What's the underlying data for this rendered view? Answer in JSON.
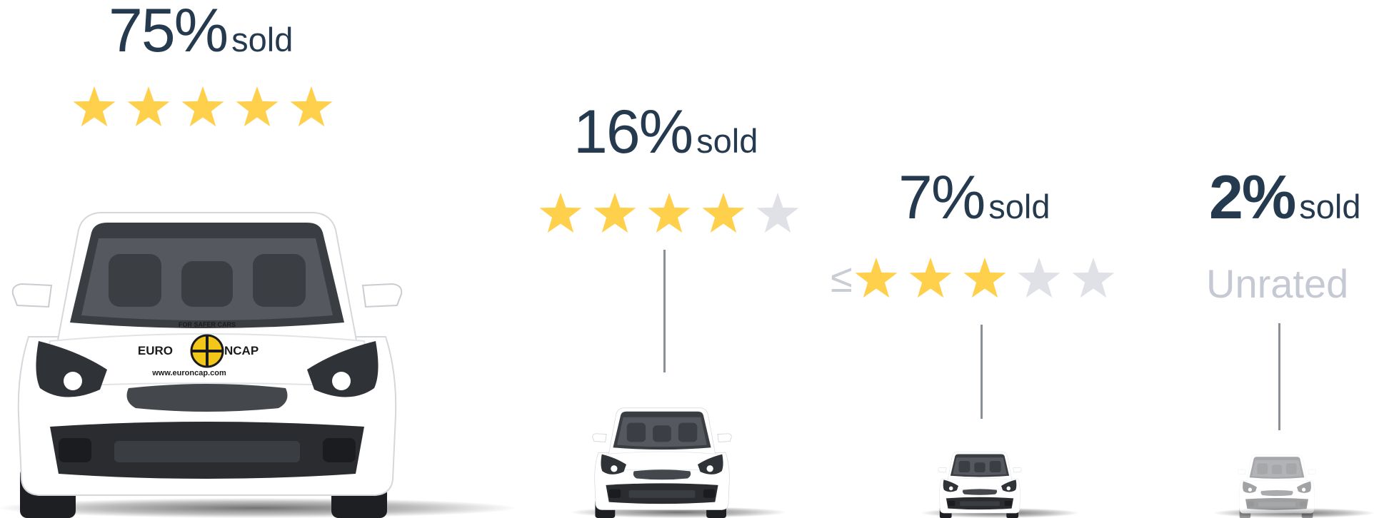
{
  "tiers": [
    {
      "percent": "75%",
      "sold": "sold",
      "filled_stars": 5,
      "total_stars": 5,
      "prefix": "",
      "unrated_label": "",
      "logo": {
        "top_text": "FOR SAFER CARS",
        "left_text": "EURO",
        "right_text": "NCAP",
        "url": "www.euroncap.com"
      }
    },
    {
      "percent": "16%",
      "sold": "sold",
      "filled_stars": 4,
      "total_stars": 5,
      "prefix": "",
      "unrated_label": ""
    },
    {
      "percent": "7%",
      "sold": "sold",
      "filled_stars": 3,
      "total_stars": 5,
      "prefix": "≤",
      "unrated_label": ""
    },
    {
      "percent": "2%",
      "sold": "sold",
      "filled_stars": 0,
      "total_stars": 0,
      "prefix": "",
      "unrated_label": "Unrated"
    }
  ],
  "colors": {
    "headline": "#253a4f",
    "star_filled": "#ffd04b",
    "star_empty": "#dfe1e6",
    "unrated": "#c5c9d3",
    "car_body": "#ffffff",
    "car_dark": "#2f3236"
  },
  "icons": {
    "star": "star-icon",
    "car": "car-icon",
    "logo": "euroncap-logo"
  }
}
